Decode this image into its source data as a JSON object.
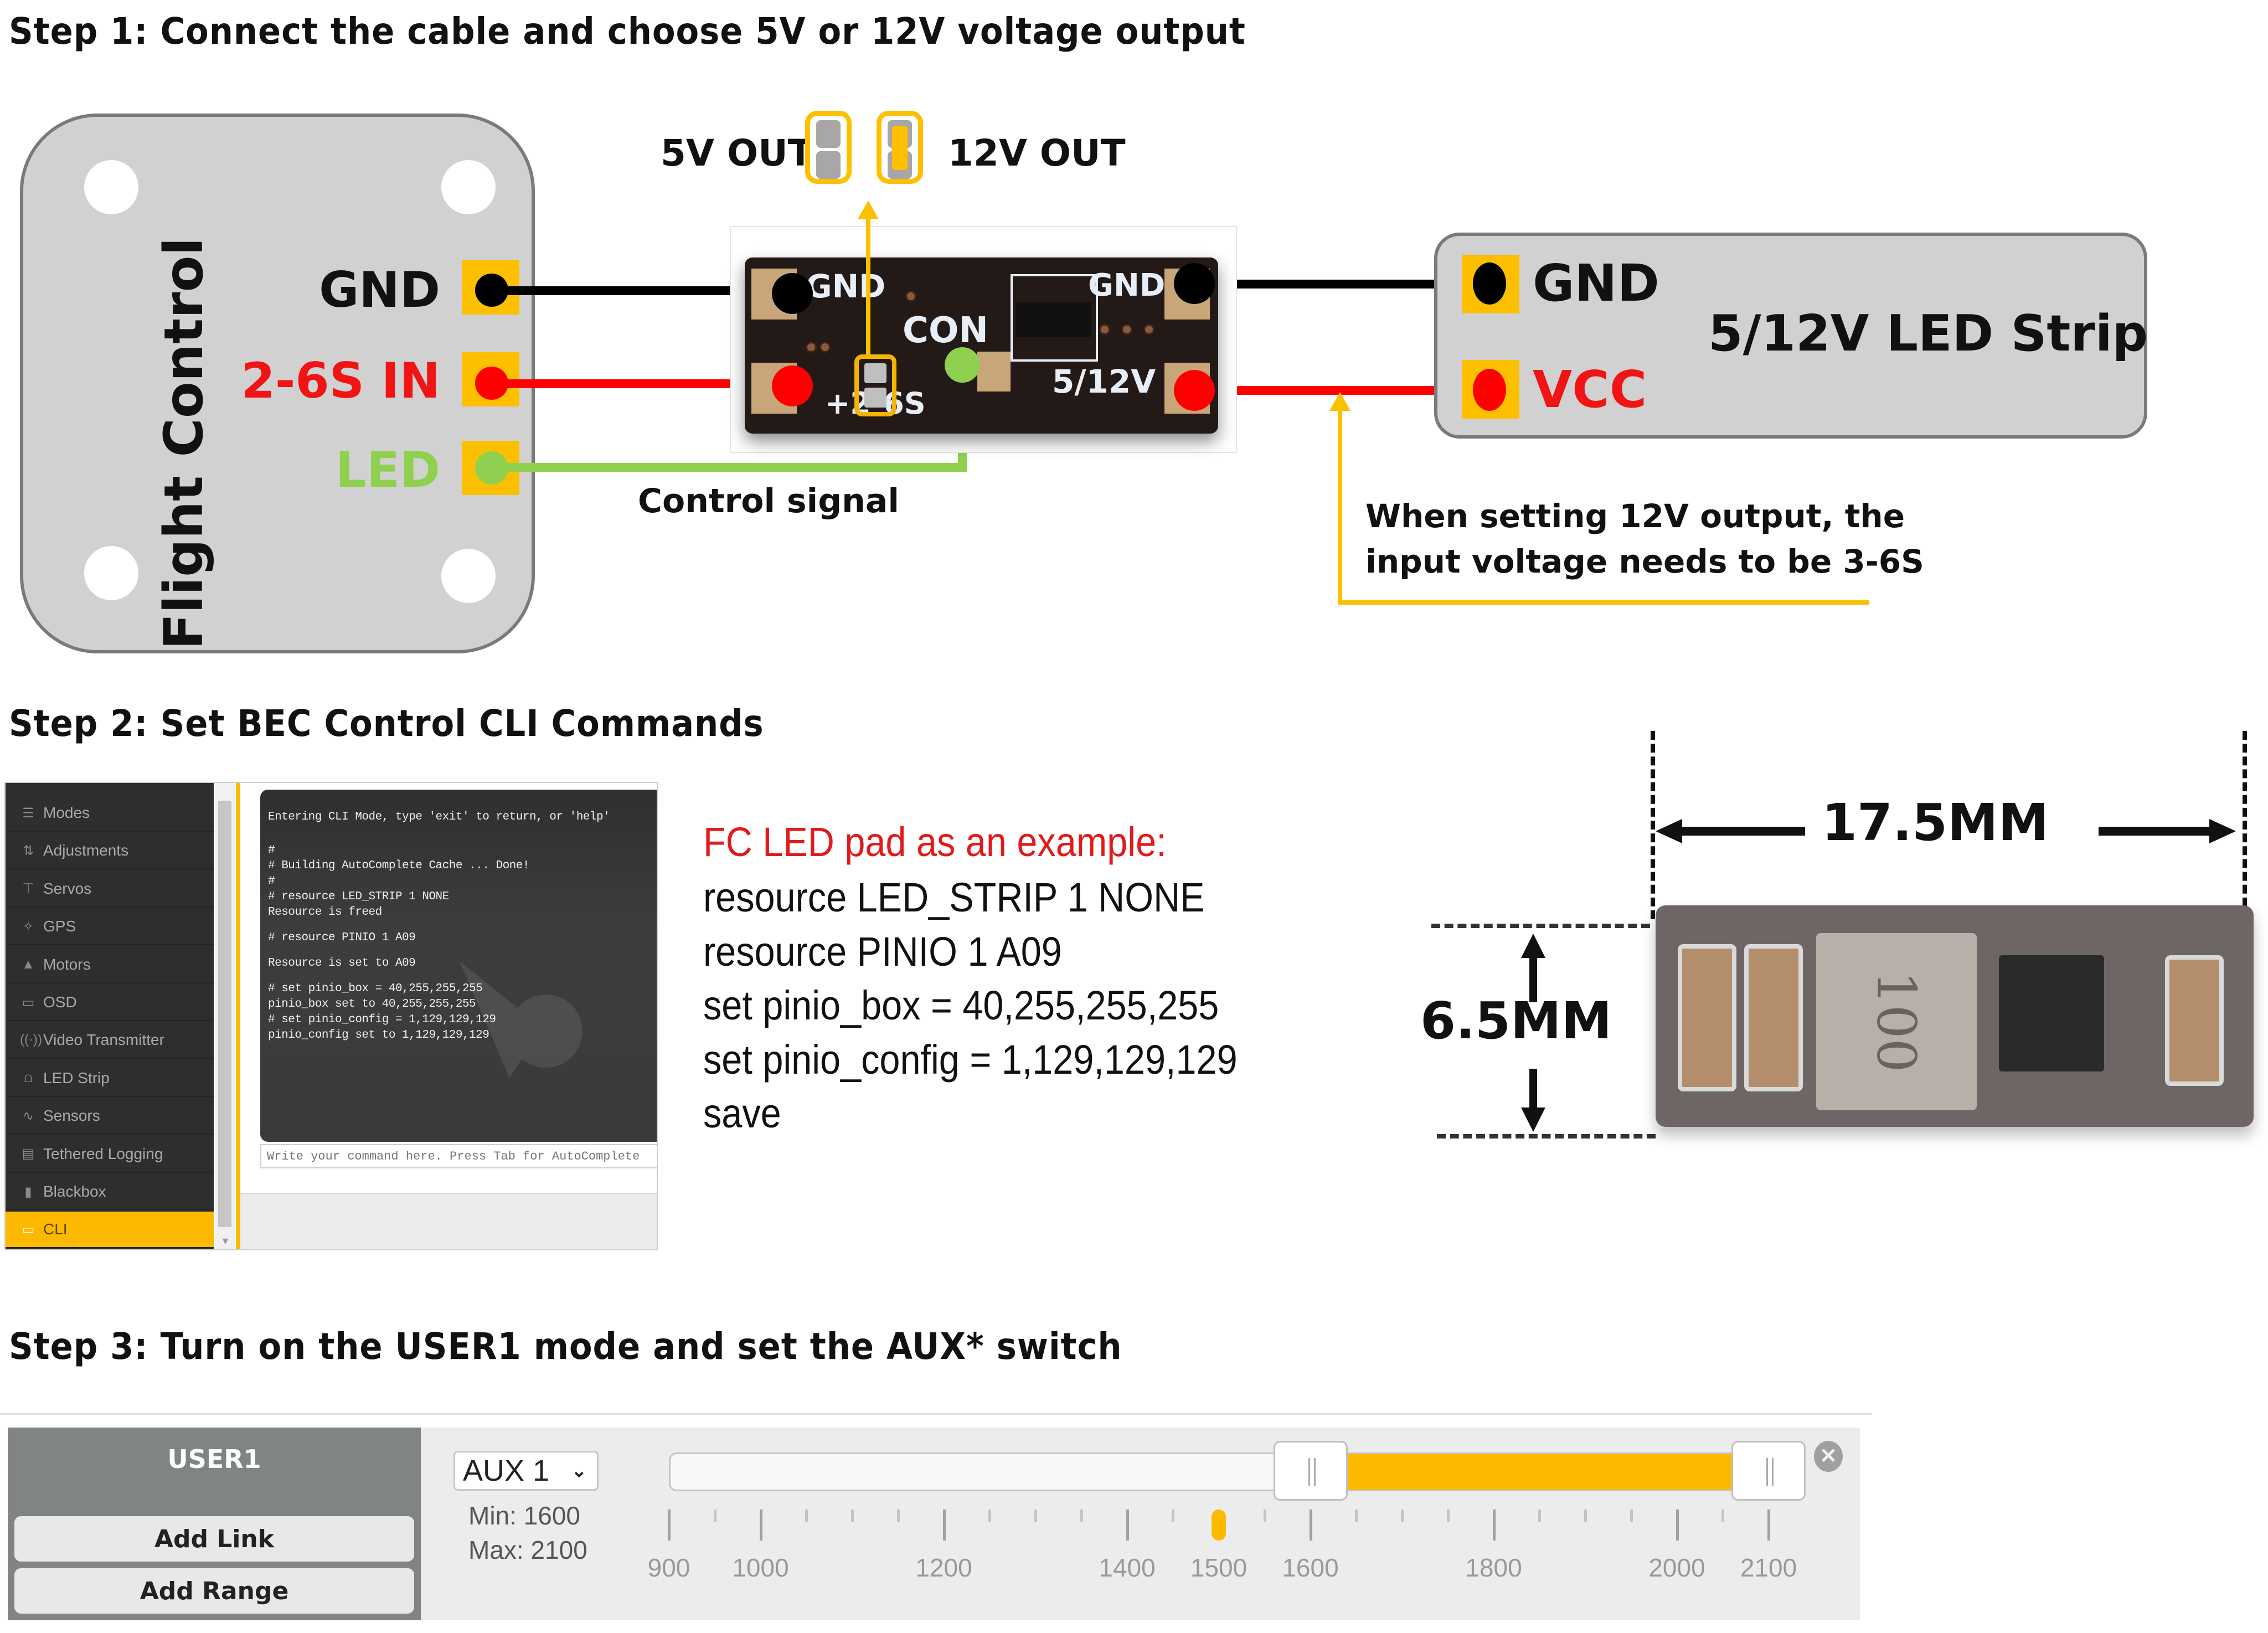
{
  "step1": {
    "heading": "Step 1: Connect the cable and choose 5V or 12V voltage output",
    "flight_control": {
      "title": "Flight Control",
      "pins": [
        {
          "label": "GND",
          "color": "#111111"
        },
        {
          "label": "2-6S IN",
          "color": "#f01414"
        },
        {
          "label": "LED",
          "color": "#8fd14f"
        }
      ]
    },
    "jumper": {
      "left_label": "5V OUT",
      "right_label": "12V OUT",
      "selected": "12V OUT"
    },
    "bec_pcb": {
      "silkscreen": [
        "GND",
        "CON",
        "GND",
        "+2-6S",
        "5/12V"
      ]
    },
    "control_signal_label": "Control signal",
    "led_strip": {
      "title": "5/12V LED Strip",
      "pins": [
        {
          "label": "GND",
          "color": "#111111"
        },
        {
          "label": "VCC",
          "color": "#f01414"
        }
      ]
    },
    "note_lines": [
      "When setting 12V output, the",
      "input voltage needs to be 3-6S"
    ],
    "colors": {
      "pad": "#fcc000",
      "gnd_wire": "#000000",
      "power_wire": "#ff0000",
      "signal_wire": "#8fd14f",
      "callout": "#fcc000"
    }
  },
  "step2": {
    "heading": "Step 2: Set BEC Control CLI Commands",
    "cli_app": {
      "nav_items": [
        {
          "label": "Modes",
          "icon": "modes-icon",
          "glyph": "☰",
          "active": false
        },
        {
          "label": "Adjustments",
          "icon": "adjustments-icon",
          "glyph": "⇅",
          "active": false
        },
        {
          "label": "Servos",
          "icon": "servos-icon",
          "glyph": "⊤",
          "active": false
        },
        {
          "label": "GPS",
          "icon": "gps-satellite-icon",
          "glyph": "✧",
          "active": false
        },
        {
          "label": "Motors",
          "icon": "motors-icon",
          "glyph": "▲",
          "active": false
        },
        {
          "label": "OSD",
          "icon": "osd-icon",
          "glyph": "▭",
          "active": false
        },
        {
          "label": "Video Transmitter",
          "icon": "video-transmitter-icon",
          "glyph": "((·))",
          "active": false
        },
        {
          "label": "LED Strip",
          "icon": "led-strip-icon",
          "glyph": "⩍",
          "active": false
        },
        {
          "label": "Sensors",
          "icon": "sensors-icon",
          "glyph": "∿",
          "active": false
        },
        {
          "label": "Tethered Logging",
          "icon": "tethered-logging-icon",
          "glyph": "▤",
          "active": false
        },
        {
          "label": "Blackbox",
          "icon": "blackbox-icon",
          "glyph": "▮",
          "active": false
        },
        {
          "label": "CLI",
          "icon": "cli-terminal-icon",
          "glyph": "▭",
          "active": true
        }
      ],
      "terminal_lines": [
        "Entering CLI Mode, type 'exit' to return, or 'help'",
        "",
        "#",
        "# Building AutoComplete Cache ... Done!",
        "#",
        "# resource LED_STRIP 1 NONE",
        "Resource is freed",
        "",
        "# resource PINIO 1 A09",
        "",
        "Resource is set to A09",
        "",
        "# set pinio_box = 40,255,255,255",
        "pinio_box set to 40,255,255,255",
        "# set pinio_config = 1,129,129,129",
        "pinio_config set to 1,129,129,129"
      ],
      "command_input": {
        "value": "",
        "placeholder": "Write your command here. Press Tab for AutoComplete"
      },
      "accent_color": "#fcb900"
    },
    "example": {
      "title": "FC LED pad as an example:",
      "title_color": "#e01b1b",
      "commands": [
        "resource LED_STRIP 1 NONE",
        "resource PINIO 1 A09",
        "set pinio_box = 40,255,255,255",
        "set pinio_config = 1,129,129,129",
        "save"
      ]
    },
    "dimensions": {
      "width_label": "17.5MM",
      "height_label": "6.5MM",
      "inductor_marking": "100"
    }
  },
  "step3": {
    "heading": "Step 3: Turn on the USER1 mode and set the AUX* switch",
    "mode": {
      "name": "USER1",
      "add_link_label": "Add Link",
      "add_range_label": "Add Range",
      "channel_selected": "AUX 1",
      "min_label": "Min: 1600",
      "max_label": "Max: 2100",
      "range_min": 1600,
      "range_max": 2100,
      "current_value": 1500,
      "scale_min": 900,
      "scale_max": 2100,
      "tick_labels": [
        "900",
        "1000",
        "1200",
        "1400",
        "1500",
        "1600",
        "1800",
        "2000",
        "2100"
      ],
      "remove_glyph": "✕",
      "fill_color": "#fcb900"
    }
  }
}
